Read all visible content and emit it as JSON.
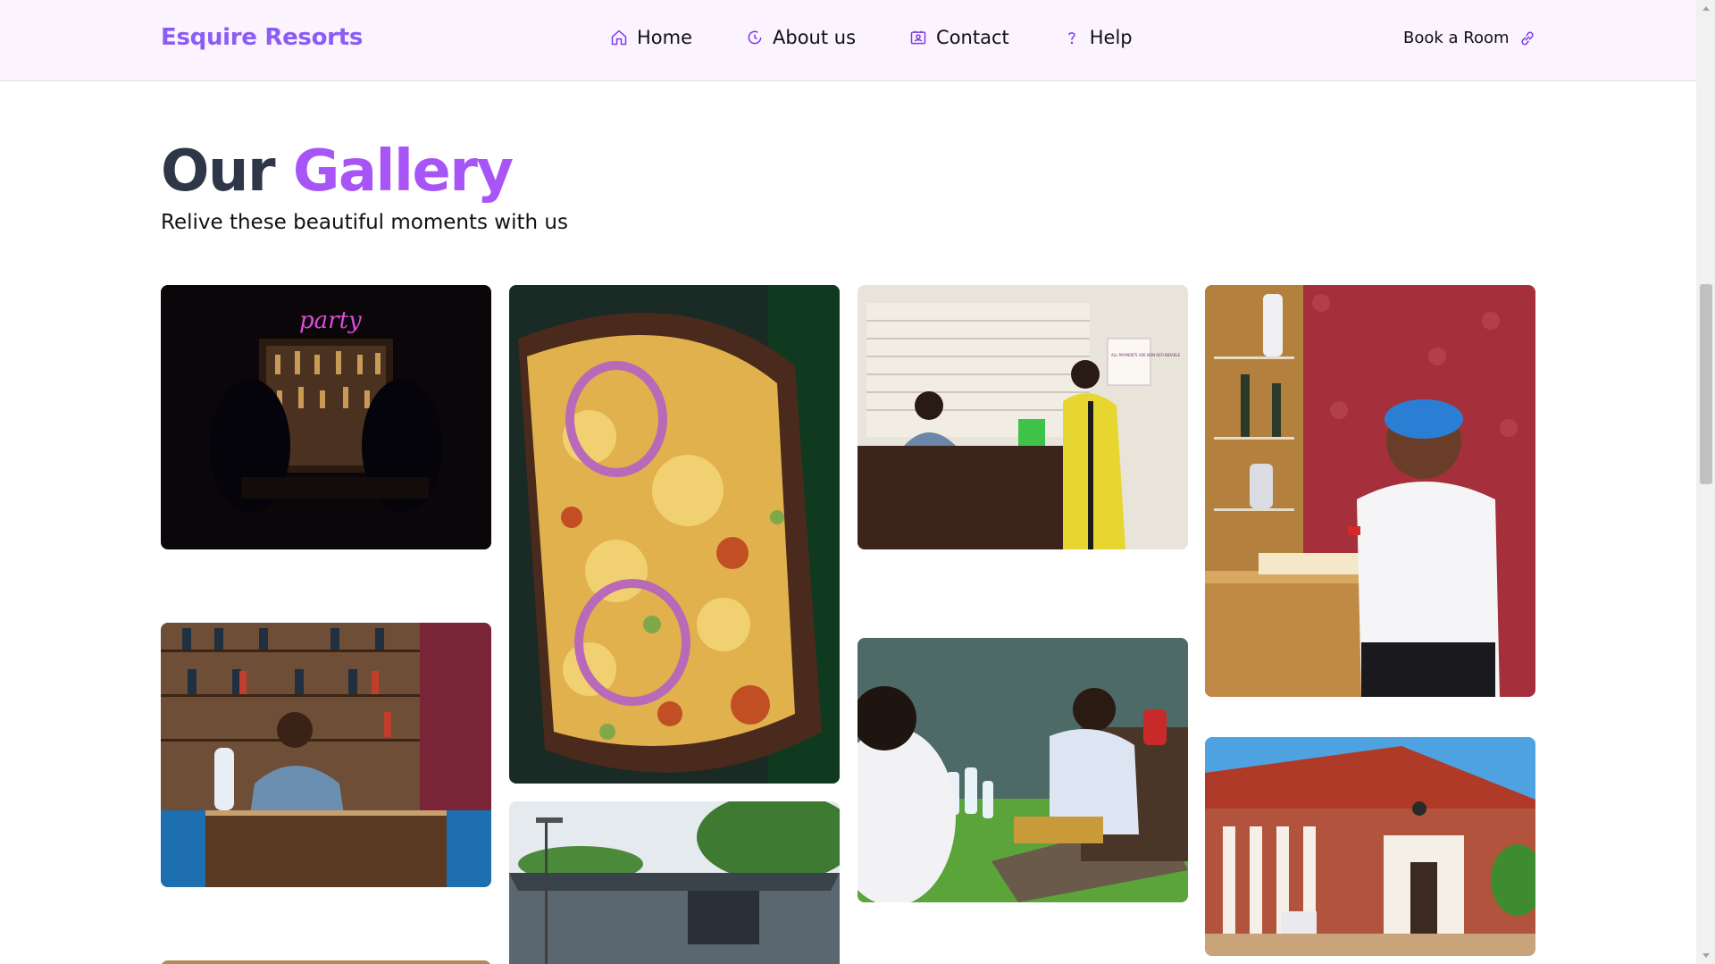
{
  "header": {
    "brand": "Esquire Resorts",
    "nav": [
      {
        "label": "Home",
        "icon": "home-icon"
      },
      {
        "label": "About us",
        "icon": "clock-icon"
      },
      {
        "label": "Contact",
        "icon": "contact-card-icon"
      },
      {
        "label": "Help",
        "icon": "question-icon"
      }
    ],
    "cta": {
      "label": "Book a Room",
      "icon": "link-icon"
    }
  },
  "gallery": {
    "title_part1": "Our",
    "title_part2": "Gallery",
    "subtitle": "Relive these beautiful moments with us",
    "neon_sign": "party",
    "notice_sign": "ALL PAYMENTS ARE NON REFUNDABLE"
  },
  "colors": {
    "brand": "#8b5cf6",
    "accent": "#a855f7",
    "heading_dark": "#2f3648",
    "nav_background": "#fbf3fd"
  }
}
